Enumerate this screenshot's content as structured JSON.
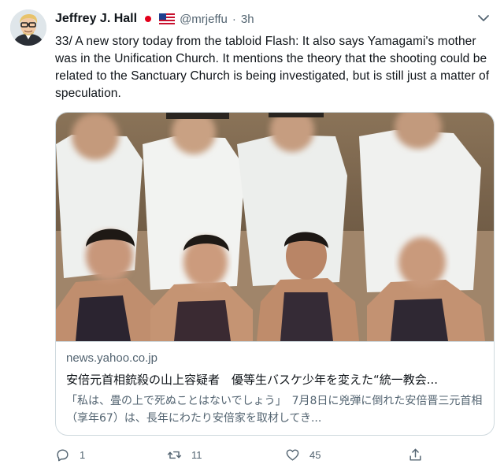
{
  "tweet": {
    "author_name": "Jeffrey J. Hall",
    "handle": "@mrjeffu",
    "separator": "·",
    "time": "3h",
    "text": "33/ A new story today from the tabloid Flash: It also says Yamagami's mother was in the Unification Church. It mentions the theory that the shooting could be related to the Sanctuary Church is being investigated, but is still just a matter of speculation.",
    "badges": [
      "flag-japan-icon",
      "flag-usa-icon"
    ]
  },
  "card": {
    "domain": "news.yahoo.co.jp",
    "title": "安倍元首相銃殺の山上容疑者　優等生バスケ少年を変えた“統一教会...",
    "description": "「私は、畳の上で死ぬことはないでしょう」　7月8日に兇弾に倒れた安倍晋三元首相（享年67）は、長年にわたり安倍家を取材してき..."
  },
  "actions": {
    "reply_count": "1",
    "retweet_count": "11",
    "like_count": "45"
  },
  "colors": {
    "text": "#0f1419",
    "secondary": "#536471",
    "border": "#cfd9de"
  }
}
